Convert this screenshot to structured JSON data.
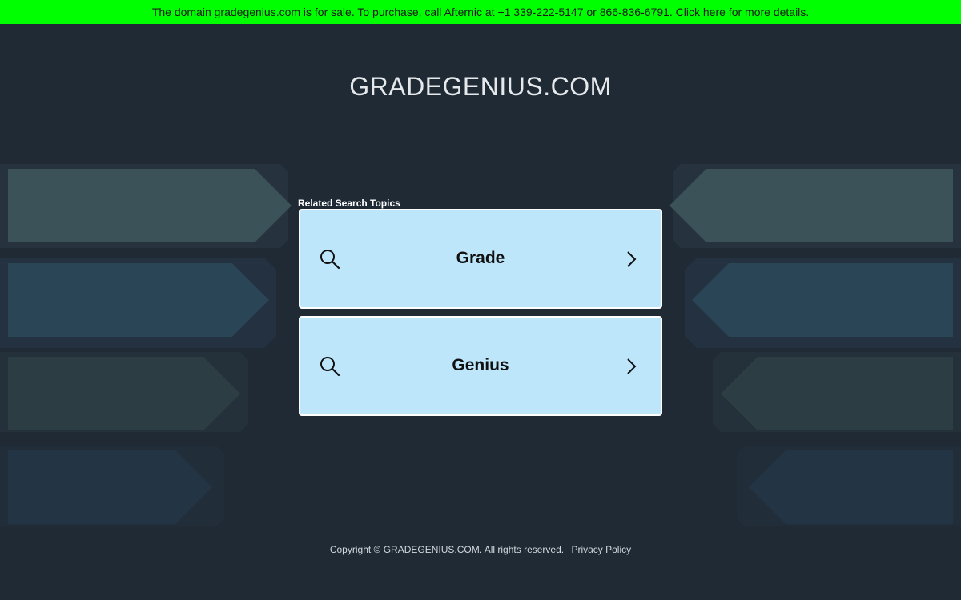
{
  "banner": {
    "text": "The domain gradegenius.com is for sale. To purchase, call Afternic at +1 339-222-5147 or 866-836-6791. Click here for more details."
  },
  "site": {
    "title": "GRADEGENIUS.COM"
  },
  "related": {
    "label": "Related Search Topics",
    "topics": [
      {
        "label": "Grade",
        "icon": "search-icon",
        "action_icon": "chevron-right-icon"
      },
      {
        "label": "Genius",
        "icon": "search-icon",
        "action_icon": "chevron-right-icon"
      }
    ]
  },
  "footer": {
    "copyright": "Copyright © GRADEGENIUS.COM.  All rights reserved.",
    "privacy_link": "Privacy Policy"
  },
  "colors": {
    "background": "#1f2a35",
    "banner": "#00ff00",
    "card": "#bde6fb",
    "card_border": "#ffffff"
  }
}
